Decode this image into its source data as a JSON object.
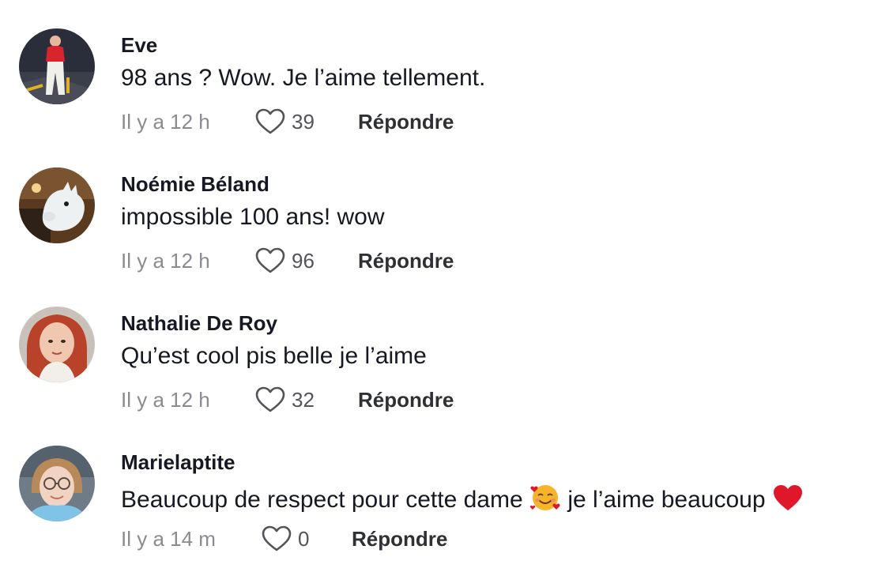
{
  "comments": [
    {
      "username": "Eve",
      "text": "98 ans ? Wow. Je l’aime tellement.",
      "time": "Il y a 12 h",
      "likes": "39",
      "reply_label": "Répondre",
      "avatar": "avatar-photo-red-outfit"
    },
    {
      "username": "Noémie Béland",
      "text": "impossible 100 ans! wow",
      "time": "Il y a 12 h",
      "likes": "96",
      "reply_label": "Répondre",
      "avatar": "avatar-photo-cartoon-character"
    },
    {
      "username": "Nathalie De Roy",
      "text": "Qu’est cool pis belle je l’aime",
      "time": "Il y a 12 h",
      "likes": "32",
      "reply_label": "Répondre",
      "avatar": "avatar-photo-red-hair-woman"
    },
    {
      "username": "Marielaptite",
      "text_before_emoji": "Beaucoup de respect pour cette dame",
      "text_after_emoji": "je l’aime beaucoup",
      "emoji_1": "smiling-face-with-hearts-emoji",
      "emoji_2": "red-heart-emoji",
      "time": "Il y a 14 m",
      "likes": "0",
      "reply_label": "Répondre",
      "avatar": "avatar-photo-glasses-woman"
    }
  ],
  "colors": {
    "text_primary": "#161823",
    "text_secondary": "#8a8b91",
    "heart_outline": "#53545a",
    "heart_emoji": "#e0162b"
  }
}
